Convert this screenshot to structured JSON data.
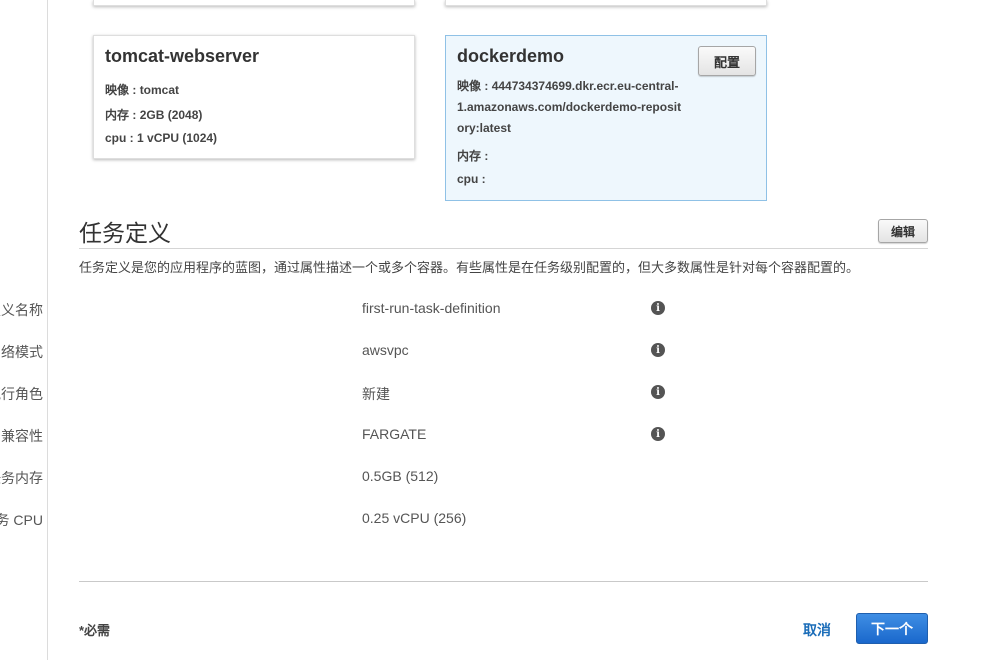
{
  "container_cards": [
    {
      "name": "tomcat-webserver",
      "image_label": "映像 :",
      "image_value": "tomcat",
      "memory_label": "内存 :",
      "memory_value": "2GB (2048)",
      "cpu_label": "cpu :",
      "cpu_value": "1 vCPU (1024)"
    },
    {
      "name": "dockerdemo",
      "configure_button": "配置",
      "image_label": "映像 :",
      "image_value": "444734374699.dkr.ecr.eu-central-1.amazonaws.com/dockerdemo-repository:latest",
      "memory_label": "内存 :",
      "memory_value": "",
      "cpu_label": "cpu :",
      "cpu_value": ""
    }
  ],
  "task_definition": {
    "title": "任务定义",
    "edit_button": "编辑",
    "description": "任务定义是您的应用程序的蓝图，通过属性描述一个或多个容器。有些属性是在任务级别配置的，但大多数属性是针对每个容器配置的。",
    "fields": [
      {
        "label": "任务定义名称",
        "value": "first-run-task-definition",
        "info_icon": "info-icon"
      },
      {
        "label": "网络模式",
        "value": "awsvpc",
        "info_icon": "info-icon"
      },
      {
        "label": "任务执行角色",
        "value": "新建",
        "info_icon": "info-icon"
      },
      {
        "label": "兼容性",
        "value": "FARGATE",
        "info_icon": "info-icon"
      },
      {
        "label": "任务内存",
        "value": "0.5GB (512)"
      },
      {
        "label": "任务 CPU",
        "value": "0.25 vCPU (256)"
      }
    ]
  },
  "footer": {
    "required_note": "*必需",
    "cancel_link": "取消",
    "next_button": "下一个"
  },
  "info_glyph": "i",
  "colors": {
    "accent_blue": "#1a6cb8",
    "primary_button": "#2672d4",
    "selected_card_bg": "#eef7fd",
    "selected_card_border": "#8fc1e6"
  }
}
